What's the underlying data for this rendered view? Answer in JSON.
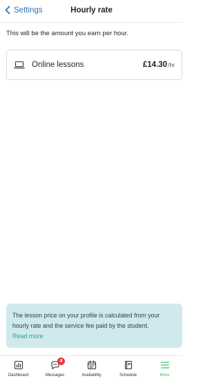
{
  "header": {
    "back_label": "Settings",
    "title": "Hourly rate"
  },
  "intro": "This will be the amount you earn per hour.",
  "rate_card": {
    "label": "Online lessons",
    "price": "£14.30",
    "unit": "/hr",
    "icon": "laptop-icon"
  },
  "notice": {
    "text": "The lesson price on your profile is calculated from your hourly rate and the service fee paid by the student.",
    "link": "Read more"
  },
  "tabbar": {
    "items": [
      {
        "label": "Dashboard",
        "icon": "dashboard-icon"
      },
      {
        "label": "Messages",
        "icon": "messages-icon",
        "badge": "4"
      },
      {
        "label": "Availability",
        "icon": "calendar-icon"
      },
      {
        "label": "Schedule",
        "icon": "schedule-icon"
      },
      {
        "label": "More",
        "icon": "menu-icon"
      }
    ],
    "active": "More"
  },
  "colors": {
    "accent_blue": "#2f6fb5",
    "active_green": "#35c26b",
    "notice_bg": "#cfe9ec",
    "badge_red": "#e83a3a"
  }
}
